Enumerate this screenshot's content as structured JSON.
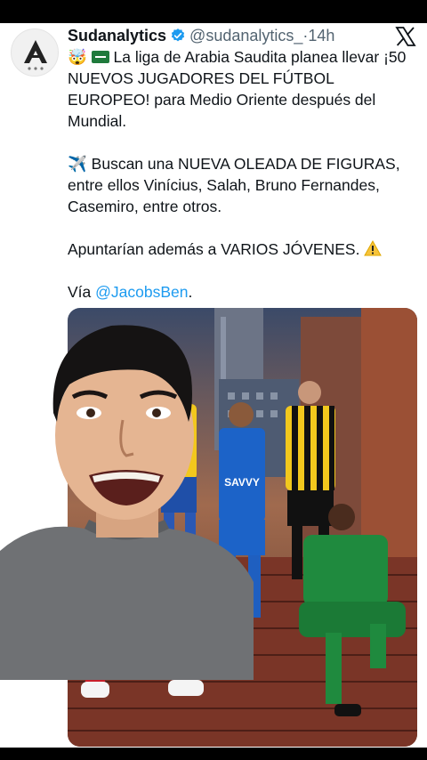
{
  "tweet": {
    "author_name": "Sudanalytics",
    "handle": "@sudanalytics_",
    "separator": "·",
    "time": "14h",
    "paragraphs": {
      "p1_emoji": "🤯",
      "p1_text": "La liga de Arabia Saudita planea llevar ¡50 NUEVOS JUGADORES DEL FÚTBOL EUROPEO! para Medio Oriente después del Mundial.",
      "p2_emoji": "✈️",
      "p2_text": "Buscan una NUEVA OLEADA DE FIGURAS, entre ellos Vinícius, Salah, Bruno Fernandes, Casemiro, entre otros.",
      "p3_text": "Apuntarían además a VARIOS JÓVENES.",
      "p4_prefix": "Vía",
      "p4_mention": "@JacobsBen",
      "p4_suffix": "."
    }
  },
  "media": {
    "jersey_sponsor_text": "SAVVY"
  },
  "icons": {
    "verified": "verified-badge-icon",
    "x_logo": "x-logo-icon",
    "warning": "warning-icon",
    "flag": "saudi-flag-icon"
  },
  "colors": {
    "accent": "#1d9bf0",
    "text": "#0f1419",
    "muted": "#536471",
    "warning": "#f6c33b"
  }
}
